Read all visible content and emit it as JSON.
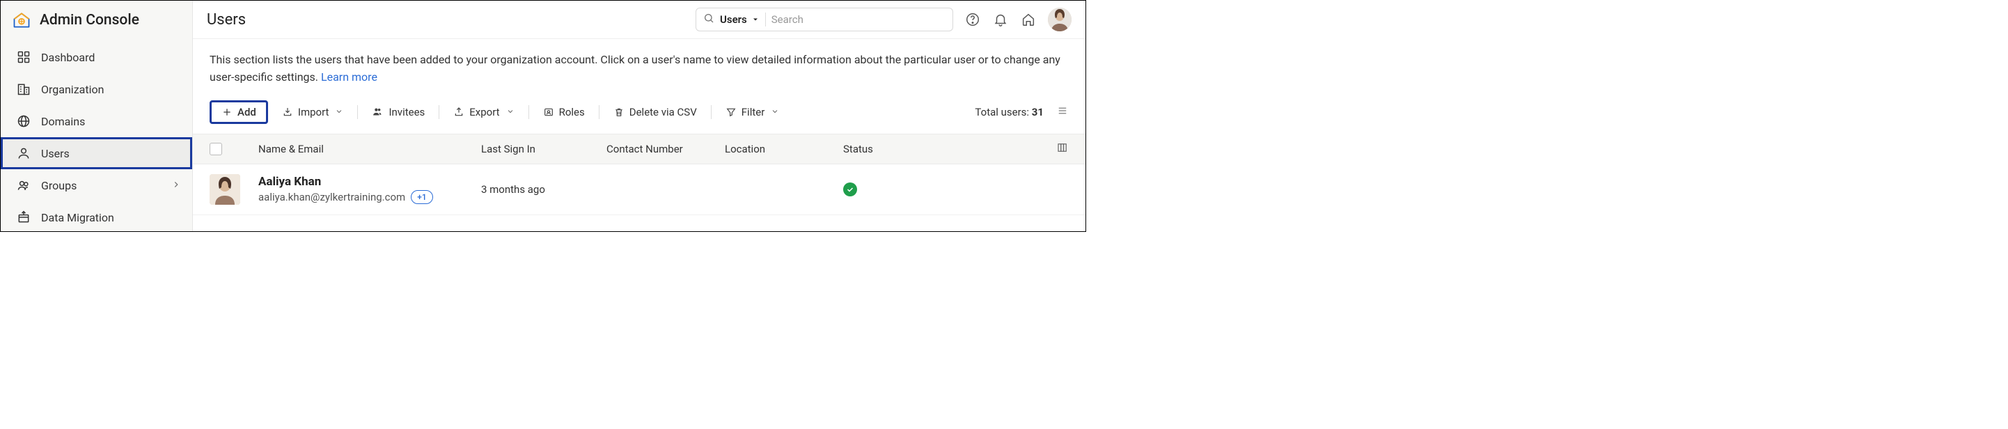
{
  "app": {
    "title": "Admin Console"
  },
  "sidebar": {
    "items": [
      {
        "label": "Dashboard",
        "id": "dashboard"
      },
      {
        "label": "Organization",
        "id": "organization"
      },
      {
        "label": "Domains",
        "id": "domains"
      },
      {
        "label": "Users",
        "id": "users"
      },
      {
        "label": "Groups",
        "id": "groups"
      },
      {
        "label": "Data Migration",
        "id": "data-migration"
      }
    ]
  },
  "header": {
    "title": "Users",
    "search_scope": "Users",
    "search_placeholder": "Search"
  },
  "description": {
    "text": "This section lists the users that have been added to your organization account. Click on a user's name to view detailed information about the particular user or to change any user-specific settings.  ",
    "learn_more": "Learn more"
  },
  "toolbar": {
    "add": "Add",
    "import": "Import",
    "invitees": "Invitees",
    "export": "Export",
    "roles": "Roles",
    "delete_csv": "Delete via CSV",
    "filter": "Filter",
    "total_label": "Total users: ",
    "total_count": "31"
  },
  "table": {
    "columns": {
      "name": "Name & Email",
      "signin": "Last Sign In",
      "contact": "Contact Number",
      "location": "Location",
      "status": "Status"
    },
    "rows": [
      {
        "name": "Aaliya Khan",
        "email": "aaliya.khan@zylkertraining.com",
        "badge": "+1",
        "last_signin": "3 months ago",
        "contact": "",
        "location": "",
        "status": "active"
      }
    ]
  }
}
